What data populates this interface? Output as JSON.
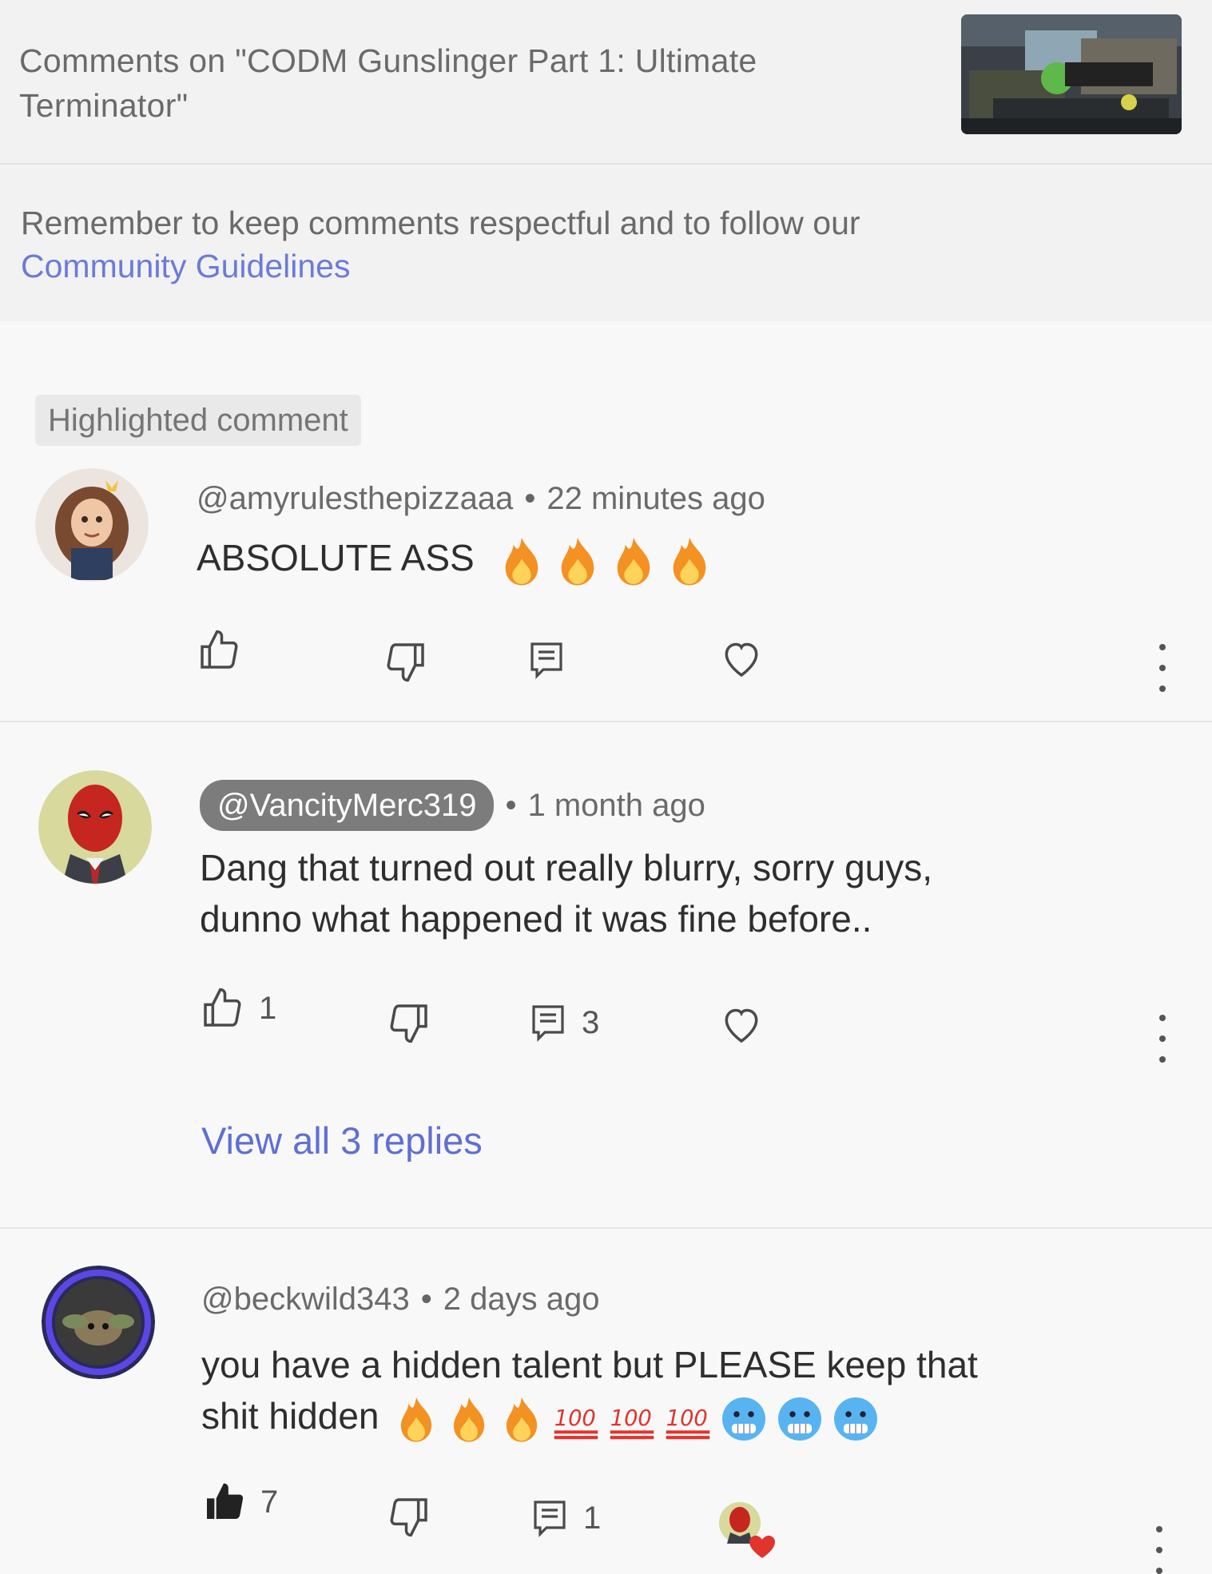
{
  "header": {
    "title": "Comments on \"CODM Gunslinger Part 1: Ultimate Terminator\"",
    "notice_text": "Remember to keep comments respectful and to follow our",
    "notice_link": "Community Guidelines"
  },
  "highlighted_label": "Highlighted comment",
  "comments": [
    {
      "handle": "@amyrulesthepizzaaa",
      "time": "22 minutes ago",
      "text": "ABSOLUTE ASS",
      "emojis": [
        "fire",
        "fire",
        "fire",
        "fire"
      ],
      "likes": "",
      "replies": ""
    },
    {
      "handle": "@VancityMerc319",
      "time": "1 month ago",
      "text_line1": "Dang that turned out really blurry, sorry guys,",
      "text_line2": "dunno what happened it was fine before..",
      "likes": "1",
      "replies": "3",
      "view_replies": "View all 3 replies"
    },
    {
      "handle": "@beckwild343",
      "time": "2 days ago",
      "text_line1": "you have a hidden talent but PLEASE keep that",
      "text_line2": "shit hidden",
      "emojis": [
        "fire",
        "fire",
        "fire",
        "100",
        "100",
        "100",
        "cold-face",
        "cold-face",
        "cold-face"
      ],
      "likes": "7",
      "replies": "1",
      "creator_hearted": true
    }
  ],
  "colors": {
    "link": "#6b7bd8",
    "chip": "#7c7c7c",
    "heart_red": "#e0342c"
  }
}
